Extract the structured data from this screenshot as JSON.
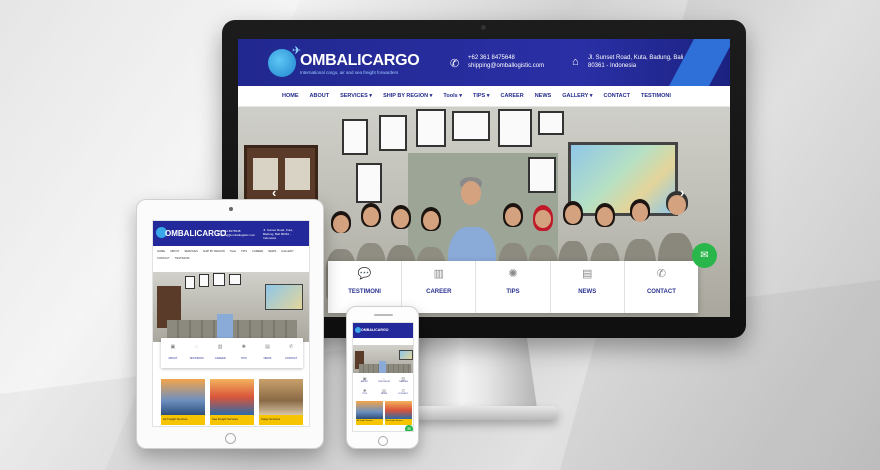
{
  "site": {
    "brand": "OMBALICARGO",
    "tagline": "International cargo, air and sea freight forwarders",
    "phone": "+62 361 8475648",
    "email": "shipping@omballogistic.com",
    "address": "Jl. Sunset Road, Kuta, Badung, Bali 80361 - Indonesia",
    "accent": "#23299a",
    "nav": [
      "HOME",
      "ABOUT",
      "SERVICES ▾",
      "SHIP BY REGION ▾",
      "Tools ▾",
      "TIPS ▾",
      "CAREER",
      "NEWS",
      "GALLERY ▾",
      "CONTACT",
      "TESTIMONI"
    ],
    "cta": [
      {
        "label": "TESTIMONI",
        "icon": "chat-bubble-icon"
      },
      {
        "label": "CAREER",
        "icon": "chart-icon"
      },
      {
        "label": "TIPS",
        "icon": "lightbulb-icon"
      },
      {
        "label": "NEWS",
        "icon": "newspaper-icon"
      },
      {
        "label": "CONTACT",
        "icon": "phone-icon"
      }
    ]
  },
  "tablet": {
    "brand": "OMBALICARGO",
    "phone": "+62 361 8475648",
    "email": "shipping@omballogistic.com",
    "address": "Jl. Sunset Road, Kuta, Badung, Bali 80361 - Indonesia",
    "nav": [
      "HOME",
      "ABOUT",
      "SERVICES",
      "SHIP BY REGION",
      "Tools",
      "TIPS",
      "CAREER",
      "NEWS",
      "GALLERY",
      "CONTACT",
      "TESTIMONI"
    ],
    "cta": [
      "ABOUT",
      "TESTIMONI",
      "CAREER",
      "TIPS",
      "NEWS",
      "CONTACT"
    ],
    "cards": [
      "Air Freight Services",
      "Sea Freight Services",
      "Cargo Services"
    ]
  },
  "phone": {
    "brand": "OMBALICARGO",
    "cta_row1": [
      "ABOUT",
      "TESTIMONI",
      "CAREER"
    ],
    "cta_row2": [
      "TIPS",
      "NEWS",
      "CONTACT"
    ],
    "cards": [
      "Air Freight Services",
      "Sea Freight Services"
    ]
  }
}
